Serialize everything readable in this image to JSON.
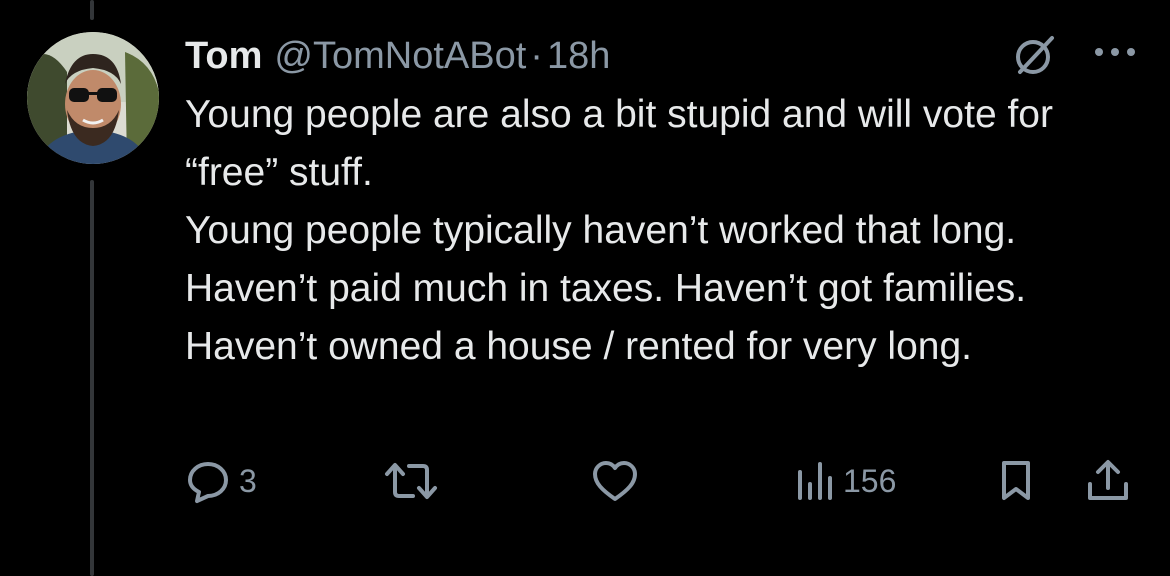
{
  "tweet": {
    "author_name": "Tom",
    "author_handle": "@TomNotABot",
    "separator": "·",
    "time_ago": "18h",
    "text_paragraphs": [
      "Young people are also a bit stupid and will vote for “free” stuff.",
      "Young people typically haven’t worked that long. Haven’t paid much in taxes. Haven’t got families. Haven’t owned a house / rented for very long."
    ]
  },
  "actions": {
    "reply_count": "3",
    "retweet_count": "",
    "like_count": "",
    "views_count": "156"
  },
  "icons": {
    "grok": "grok-icon",
    "more": "more-icon",
    "reply": "reply-icon",
    "retweet": "retweet-icon",
    "like": "heart-icon",
    "views": "views-icon",
    "bookmark": "bookmark-icon",
    "share": "share-icon"
  },
  "colors": {
    "background": "#000000",
    "primary_text": "#e7e9ea",
    "secondary_text": "#8b98a5",
    "thread_line": "#333639"
  }
}
